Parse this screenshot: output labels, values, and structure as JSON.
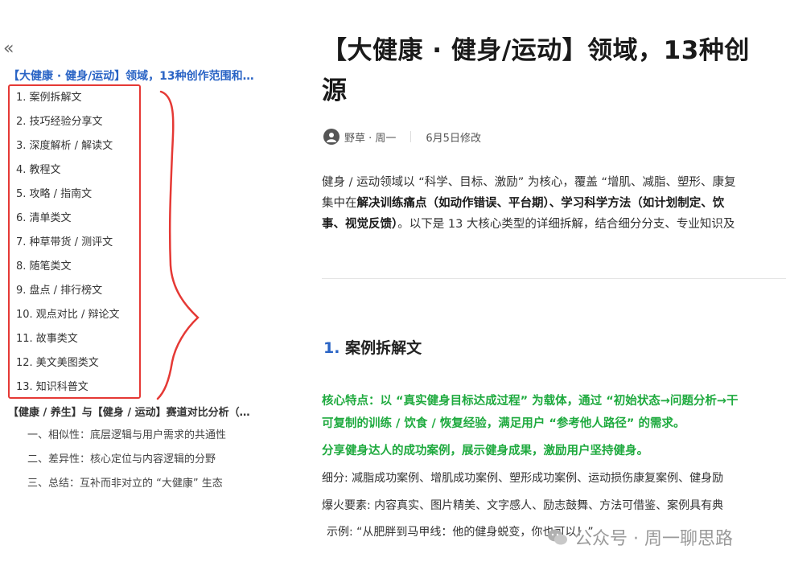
{
  "sidebar": {
    "collapse_icon": "«",
    "toc_title": "【大健康 · 健身/运动】领域，13种创作范围和…",
    "items": [
      "1. 案例拆解文",
      "2. 技巧经验分享文",
      "3. 深度解析 / 解读文",
      "4. 教程文",
      "5. 攻略 / 指南文",
      "6. 清单类文",
      "7. 种草带货 / 测评文",
      "8. 随笔类文",
      "9. 盘点 / 排行榜文",
      "10. 观点对比 / 辩论文",
      "11. 故事类文",
      "12. 美文美图类文",
      "13. 知识科普文"
    ],
    "toc_title2": "【健康 / 养生】与【健身 / 运动】赛道对比分析（…",
    "sub_items": [
      "一、相似性：底层逻辑与用户需求的共通性",
      "二、差异性：核心定位与内容逻辑的分野",
      "三、总结：互补而非对立的 “大健康” 生态"
    ]
  },
  "article": {
    "title": "【大健康 · 健身/运动】领域，13种创\n源",
    "author": "野草 · 周一",
    "date": "6月5日修改",
    "intro": {
      "line1": "健身 / 运动领域以 “科学、目标、激励” 为核心，覆盖 “增肌、减脂、塑形、康复",
      "line2_pre": "集中在",
      "line2_bold": "解决训练痛点（如动作错误、平台期）、学习科学方法（如计划制定、饮",
      "line3_bold": "事、视觉反馈）",
      "line3_post": "。以下是 13 大核心类型的详细拆解，结合细分分支、专业知识及"
    },
    "section": {
      "num": "1.",
      "title": "案例拆解文"
    },
    "green1": "核心特点：以 “真实健身目标达成过程” 为载体，通过 “初始状态→问题分析→干",
    "green2": "可复制的训练 / 饮食 / 恢复经验，满足用户 “参考他人路径” 的需求。",
    "green3": "分享健身达人的成功案例，展示健身成果，激励用户坚持健身。",
    "sub": "细分: 减脂成功案例、增肌成功案例、塑形成功案例、运动损伤康复案例、健身励",
    "explode": "爆火要素: 内容真实、图片精美、文字感人、励志鼓舞、方法可借鉴、案例具有典",
    "example": "示例: “从肥胖到马甲线：他的健身蜕变，你也可以！”"
  },
  "watermark": "公众号 · 周一聊思路",
  "colors": {
    "link_blue": "#2a64c5",
    "highlight_green": "#1faa3f",
    "annotation_red": "#e53935"
  }
}
